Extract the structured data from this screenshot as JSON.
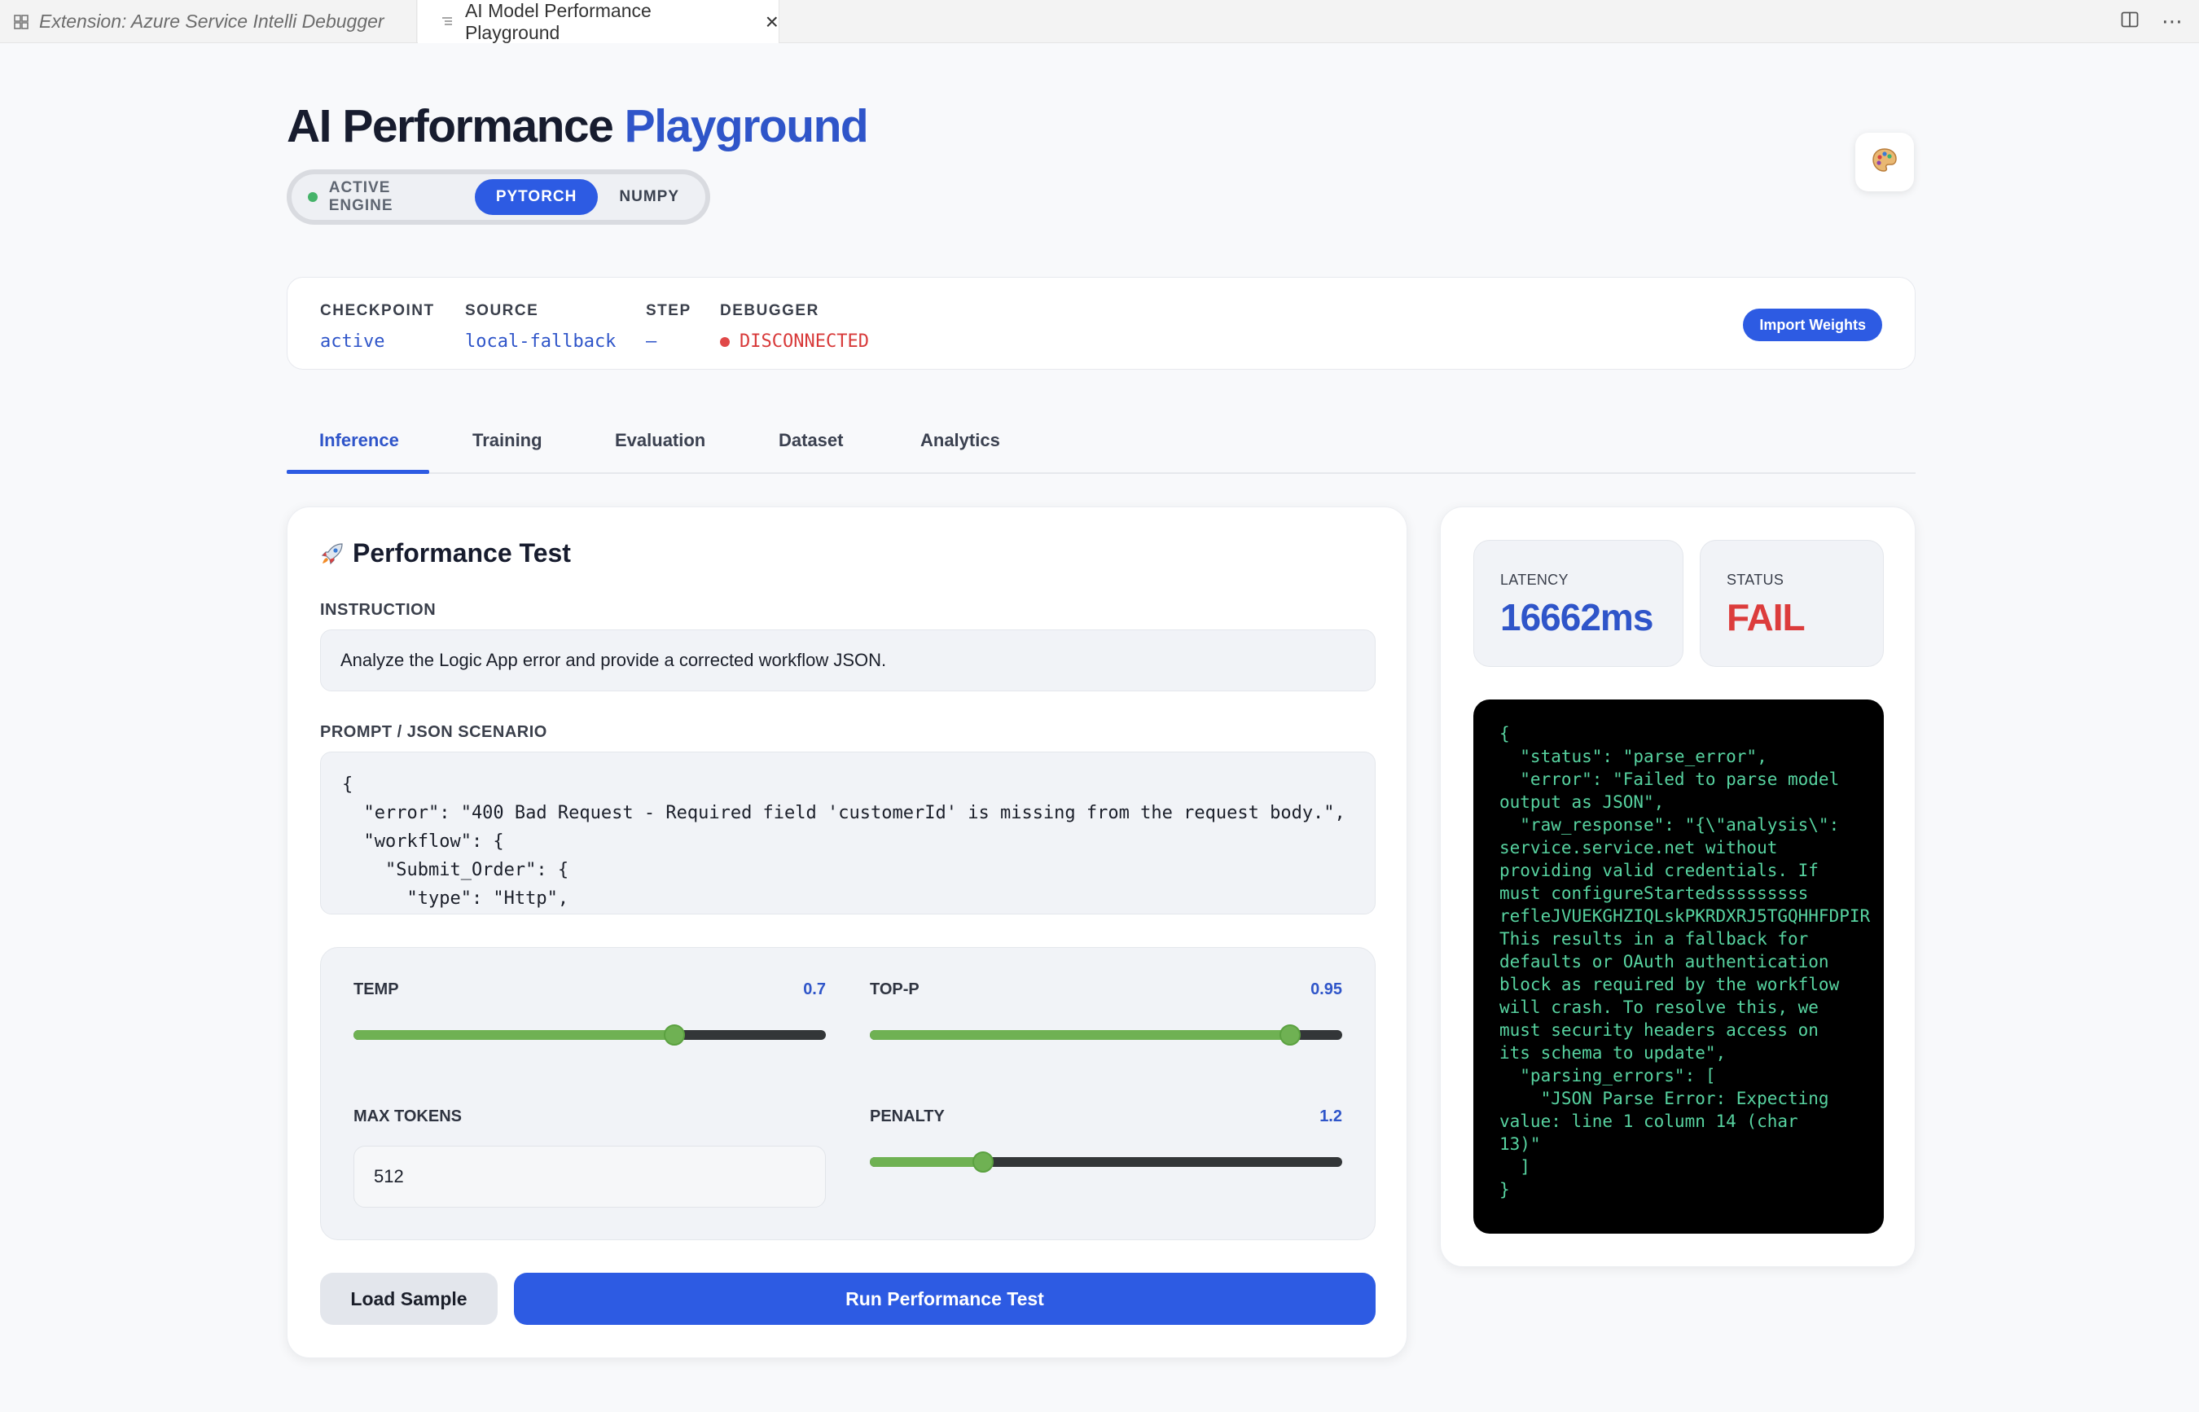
{
  "tabs": [
    {
      "label": "Extension: Azure Service Intelli Debugger",
      "icon": "extension-icon"
    },
    {
      "label": "AI Model Performance Playground",
      "icon": "preview-icon"
    }
  ],
  "header": {
    "title_main": "AI Performance",
    "title_accent": "Playground",
    "engine": {
      "label": "ACTIVE ENGINE",
      "options": [
        "PYTORCH",
        "NUMPY"
      ],
      "selected": "PYTORCH"
    }
  },
  "status": {
    "checkpoint": {
      "label": "CHECKPOINT",
      "value": "active"
    },
    "source": {
      "label": "SOURCE",
      "value": "local-fallback"
    },
    "step": {
      "label": "STEP",
      "value": "—"
    },
    "debugger": {
      "label": "DEBUGGER",
      "value": "DISCONNECTED"
    },
    "import_label": "Import Weights"
  },
  "nav": [
    "Inference",
    "Training",
    "Evaluation",
    "Dataset",
    "Analytics"
  ],
  "perf": {
    "title": "Performance Test",
    "instruction_label": "INSTRUCTION",
    "instruction_value": "Analyze the Logic App error and provide a corrected workflow JSON.",
    "prompt_label": "PROMPT / JSON SCENARIO",
    "prompt_value": "{\n  \"error\": \"400 Bad Request - Required field 'customerId' is missing from the request body.\",\n  \"workflow\": {\n    \"Submit_Order\": {\n      \"type\": \"Http\",",
    "params": {
      "temp": {
        "label": "TEMP",
        "value": "0.7",
        "fraction": 0.68
      },
      "top_p": {
        "label": "TOP-P",
        "value": "0.95",
        "fraction": 0.89
      },
      "max_tokens": {
        "label": "MAX TOKENS",
        "value": "512"
      },
      "penalty": {
        "label": "PENALTY",
        "value": "1.2",
        "fraction": 0.24
      }
    },
    "load_label": "Load Sample",
    "run_label": "Run Performance Test"
  },
  "results": {
    "latency_label": "LATENCY",
    "latency_value": "16662ms",
    "status_label": "STATUS",
    "status_value": "FAIL",
    "output": "{\n  \"status\": \"parse_error\",\n  \"error\": \"Failed to parse model\noutput as JSON\",\n  \"raw_response\": \"{\\\"analysis\\\":\nservice.service.net without\nproviding valid credentials. If\nmust configureStartedsssssssss\nrefleJVUEKGHZIQLskPKRDXRJ5TGQHHFDPIR\nThis results in a fallback for\ndefaults or OAuth authentication\nblock as required by the workflow\nwill crash. To resolve this, we\nmust security headers access on\nits schema to update\",\n  \"parsing_errors\": [\n    \"JSON Parse Error: Expecting\nvalue: line 1 column 14 (char\n13)\"\n  ]\n}"
  }
}
